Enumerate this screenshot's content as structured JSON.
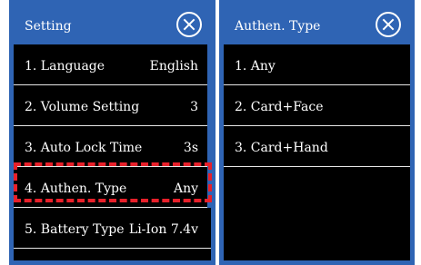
{
  "left_panel": {
    "title": "Setting",
    "items": [
      {
        "label": "1. Language",
        "value": "English"
      },
      {
        "label": "2. Volume Setting",
        "value": "3"
      },
      {
        "label": "3. Auto Lock Time",
        "value": "3s"
      },
      {
        "label": "4. Authen. Type",
        "value": "Any"
      },
      {
        "label": "5. Battery Type",
        "value": "Li-Ion 7.4v"
      }
    ]
  },
  "right_panel": {
    "title": "Authen. Type",
    "items": [
      {
        "label": "1. Any"
      },
      {
        "label": "2. Card+Face"
      },
      {
        "label": "3. Card+Hand"
      }
    ]
  },
  "icons": {
    "close": "close-circle-icon"
  },
  "colors": {
    "header": "#2f64b4",
    "background": "#000000",
    "highlight": "#e8202a"
  }
}
